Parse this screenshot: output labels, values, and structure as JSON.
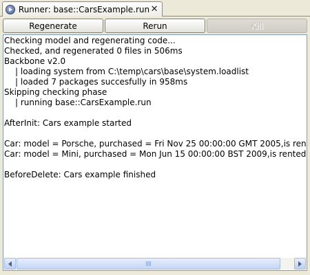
{
  "tab": {
    "title": "Runner: base::CarsExample.run",
    "close_glyph": "✕",
    "icon": "run-icon"
  },
  "toolbar": {
    "regenerate_label": "Regenerate",
    "rerun_label": "Rerun",
    "kill_label": "Kill"
  },
  "console": {
    "lines": [
      "Checking model and regenerating code...",
      "Checked, and regenerated 0 files in 506ms",
      "Backbone v2.0",
      "| loading system from C:\\temp\\cars\\base\\system.loadlist",
      "| loaded 7 packages succesfully in 958ms",
      "Skipping checking phase",
      "| running base::CarsExample.run",
      "",
      "AfterInit: Cars example started",
      "",
      "Car: model = Porsche, purchased = Fri Nov 25 00:00:00 GMT 2005,is rented = false",
      "Car: model = Mini, purchased = Mon Jun 15 00:00:00 BST 2009,is rented = false",
      "",
      "BeforeDelete: Cars example finished"
    ]
  },
  "colors": {
    "window_bg": "#ece9d8",
    "console_bg": "#ffffff",
    "border": "#7f9db9"
  }
}
